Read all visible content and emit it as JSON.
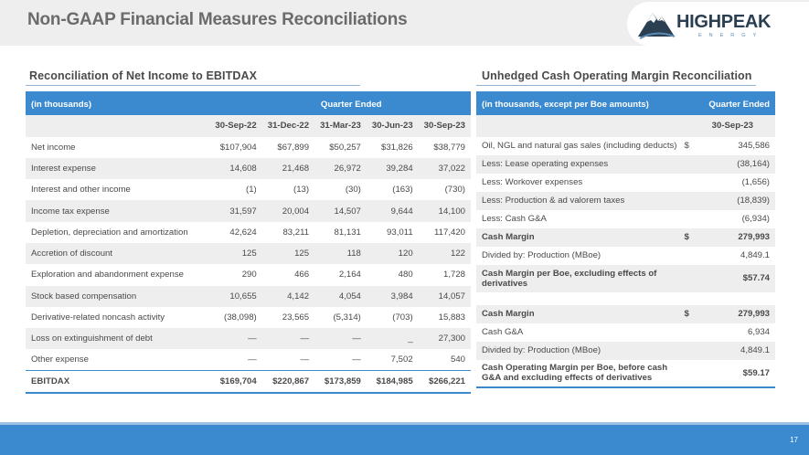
{
  "page": {
    "title": "Non-GAAP Financial Measures Reconciliations",
    "page_number": "17"
  },
  "logo": {
    "word": "HIGHPEAK",
    "sub": "ENERGY"
  },
  "left": {
    "title": "Reconciliation of Net Income to EBITDAX",
    "header_label": "(in thousands)",
    "header_group": "Quarter Ended",
    "columns": [
      "30-Sep-22",
      "31-Dec-22",
      "31-Mar-23",
      "30-Jun-23",
      "30-Sep-23"
    ],
    "rows": [
      {
        "label": "Net income",
        "values": [
          "$107,904",
          "$67,899",
          "$50,257",
          "$31,826",
          "$38,779"
        ]
      },
      {
        "label": "Interest expense",
        "values": [
          "14,608",
          "21,468",
          "26,972",
          "39,284",
          "37,022"
        ]
      },
      {
        "label": "Interest and other income",
        "values": [
          "(1)",
          "(13)",
          "(30)",
          "(163)",
          "(730)"
        ]
      },
      {
        "label": "Income tax expense",
        "values": [
          "31,597",
          "20,004",
          "14,507",
          "9,644",
          "14,100"
        ]
      },
      {
        "label": "Depletion, depreciation and amortization",
        "values": [
          "42,624",
          "83,211",
          "81,131",
          "93,011",
          "117,420"
        ]
      },
      {
        "label": "Accretion of discount",
        "values": [
          "125",
          "125",
          "118",
          "120",
          "122"
        ]
      },
      {
        "label": "Exploration and abandonment expense",
        "values": [
          "290",
          "466",
          "2,164",
          "480",
          "1,728"
        ]
      },
      {
        "label": "Stock based compensation",
        "values": [
          "10,655",
          "4,142",
          "4,054",
          "3,984",
          "14,057"
        ]
      },
      {
        "label": "Derivative-related noncash activity",
        "values": [
          "(38,098)",
          "23,565",
          "(5,314)",
          "(703)",
          "15,883"
        ]
      },
      {
        "label": "Loss on extinguishment of debt",
        "values": [
          "—",
          "—",
          "—",
          "_",
          "27,300"
        ]
      },
      {
        "label": "Other expense",
        "values": [
          "—",
          "—",
          "—",
          "7,502",
          "540"
        ]
      }
    ],
    "total": {
      "label": "EBITDAX",
      "values": [
        "$169,704",
        "$220,867",
        "$173,859",
        "$184,985",
        "$266,221"
      ]
    }
  },
  "right": {
    "title": "Unhedged Cash Operating Margin Reconciliation",
    "header_label": "(in thousands, except per Boe amounts)",
    "header_group": "Quarter Ended",
    "column": "30-Sep-23",
    "rows": [
      {
        "label": "Oil, NGL and natural gas sales (including deducts)",
        "cur": "$",
        "value": "345,586"
      },
      {
        "label": "Less: Lease operating expenses",
        "cur": "",
        "value": "(38,164)"
      },
      {
        "label": "Less: Workover expenses",
        "cur": "",
        "value": "(1,656)"
      },
      {
        "label": "Less: Production & ad valorem taxes",
        "cur": "",
        "value": "(18,839)"
      },
      {
        "label": "Less: Cash G&A",
        "cur": "",
        "value": "(6,934)"
      },
      {
        "label": "Cash Margin",
        "cur": "$",
        "value": "279,993"
      },
      {
        "label": "Divided by: Production (MBoe)",
        "cur": "",
        "value": "4,849.1"
      },
      {
        "label": "Cash Margin per Boe, excluding effects of derivatives",
        "cur": "",
        "value": "$57.74"
      },
      {
        "label": "Cash Margin",
        "cur": "$",
        "value": "279,993"
      },
      {
        "label": "Cash G&A",
        "cur": "",
        "value": "6,934"
      },
      {
        "label": "Divided by: Production (MBoe)",
        "cur": "",
        "value": "4,849.1"
      },
      {
        "label": "Cash Operating Margin per Boe, before cash G&A and excluding effects of derivatives",
        "cur": "",
        "value": "$59.17"
      }
    ]
  },
  "colors": {
    "accent_blue": "#3b8ad0",
    "shade_gray": "#eeeeee",
    "logo_navy": "#2a3f52"
  }
}
